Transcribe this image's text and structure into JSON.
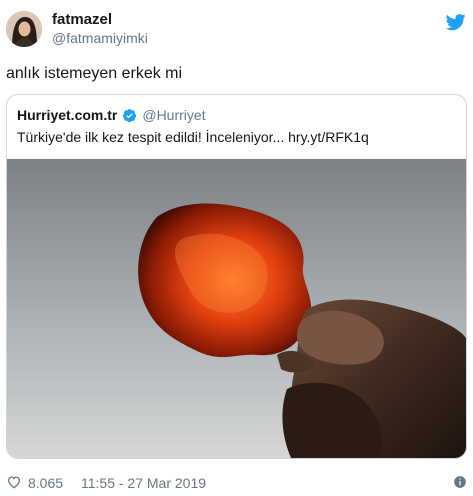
{
  "tweet": {
    "author": {
      "display_name": "fatmazel",
      "handle": "@fatmamiyimki",
      "avatar": "avatar-photo"
    },
    "brand_icon": "twitter-bird-icon",
    "text": "anlık istemeyen erkek mi",
    "quoted": {
      "display_name": "Hurriyet.com.tr",
      "verified_icon": "verified-badge-icon",
      "handle": "@Hurriyet",
      "text": "Türkiye'de ilk kez tespit edildi! İnceleniyor... hry.yt/RFK1q",
      "media": "photo-amber-stone-held-against-sky"
    },
    "footer": {
      "like_icon": "heart-icon",
      "like_count": "8.065",
      "timestamp": "11:55 - 27 Mar 2019",
      "info_icon": "info-icon"
    }
  },
  "colors": {
    "primary_text": "#14171a",
    "secondary_text": "#657786",
    "twitter_blue": "#1da1f2",
    "border": "#ccd6dd"
  }
}
